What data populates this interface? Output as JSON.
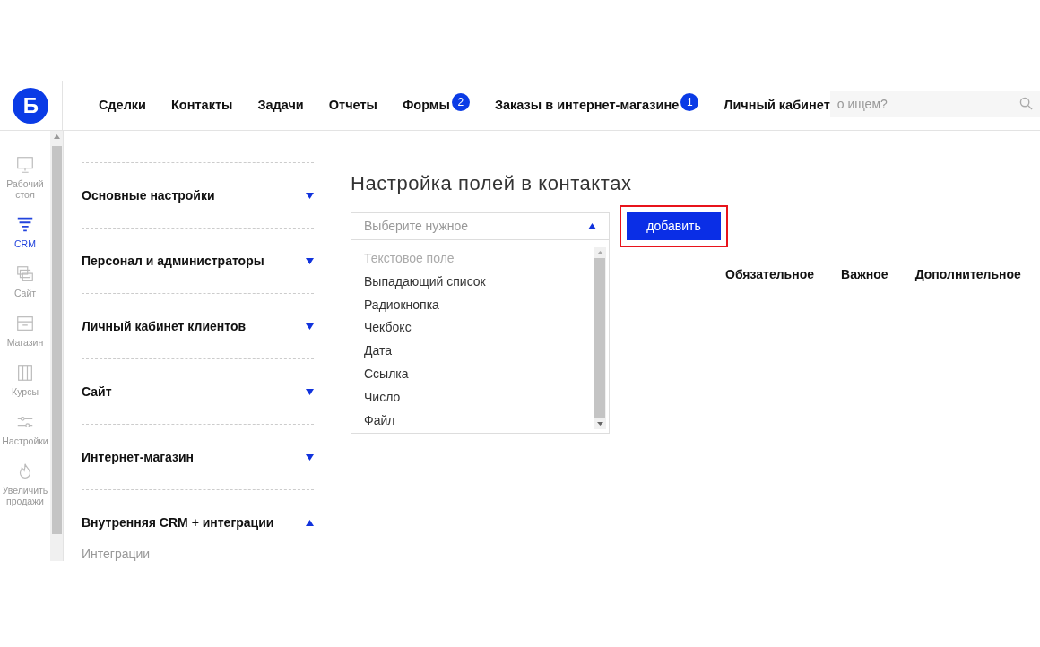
{
  "logo": {
    "letter": "Б"
  },
  "nav": [
    {
      "label": "Сделки"
    },
    {
      "label": "Контакты"
    },
    {
      "label": "Задачи"
    },
    {
      "label": "Отчеты"
    },
    {
      "label": "Формы",
      "badge": "2"
    },
    {
      "label": "Заказы в интернет-магазине",
      "badge": "1"
    },
    {
      "label": "Личный кабинет"
    }
  ],
  "search": {
    "placeholder": "о ищем?"
  },
  "sidebar": {
    "items": [
      {
        "label": "Рабочий стол",
        "kind": "monitor",
        "selected": false
      },
      {
        "label": "CRM",
        "kind": "funnel",
        "selected": true
      },
      {
        "label": "Сайт",
        "kind": "windows",
        "selected": false
      },
      {
        "label": "Магазин",
        "kind": "drawer",
        "selected": false
      },
      {
        "label": "Курсы",
        "kind": "books",
        "selected": false
      },
      {
        "label": "Настройки",
        "kind": "sliders",
        "selected": false
      },
      {
        "label": "Увеличить продажи",
        "kind": "flame",
        "selected": false
      }
    ]
  },
  "settings_menu": [
    {
      "label": "Основные настройки",
      "expanded": false
    },
    {
      "label": "Персонал и администраторы",
      "expanded": false
    },
    {
      "label": "Личный кабинет клиентов",
      "expanded": false
    },
    {
      "label": "Сайт",
      "expanded": false
    },
    {
      "label": "Интернет-магазин",
      "expanded": false
    },
    {
      "label": "Внутренняя CRM + интеграции",
      "expanded": true,
      "children": [
        {
          "label": "Интеграции"
        }
      ]
    }
  ],
  "title": "Настройка полей в контактах",
  "select": {
    "placeholder": "Выберите нужное",
    "expanded": true,
    "options": [
      {
        "label": "Текстовое поле",
        "disabled": true
      },
      {
        "label": "Выпадающий список",
        "disabled": false
      },
      {
        "label": "Радиокнопка",
        "disabled": false
      },
      {
        "label": "Чекбокс",
        "disabled": false
      },
      {
        "label": "Дата",
        "disabled": false
      },
      {
        "label": "Ссылка",
        "disabled": false
      },
      {
        "label": "Число",
        "disabled": false
      },
      {
        "label": "Файл",
        "disabled": false
      }
    ]
  },
  "add_button": {
    "label": "добавить",
    "highlighted": true
  },
  "columns": [
    "Обязательное",
    "Важное",
    "Дополнительное"
  ]
}
